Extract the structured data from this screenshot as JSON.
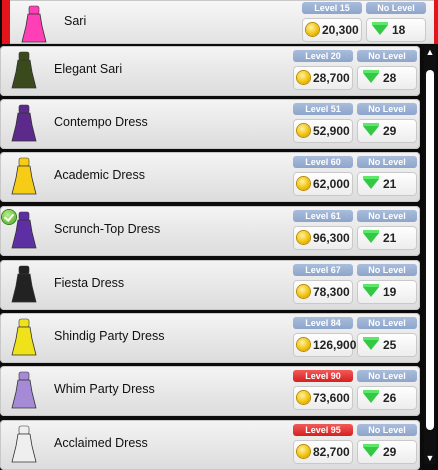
{
  "items": [
    {
      "name": "Sari",
      "level": "Level 15",
      "level_color": "blue",
      "coins": "20,300",
      "gem_level": "No Level",
      "gems": "18",
      "dress_color": "#ff3fb6",
      "owned": false
    },
    {
      "name": "Elegant Sari",
      "level": "Level 20",
      "level_color": "blue",
      "coins": "28,700",
      "gem_level": "No Level",
      "gems": "28",
      "dress_color": "#3a4a1d",
      "owned": false
    },
    {
      "name": "Contempo Dress",
      "level": "Level 51",
      "level_color": "blue",
      "coins": "52,900",
      "gem_level": "No Level",
      "gems": "29",
      "dress_color": "#5b2a8a",
      "owned": false
    },
    {
      "name": "Academic Dress",
      "level": "Level 60",
      "level_color": "blue",
      "coins": "62,000",
      "gem_level": "No Level",
      "gems": "21",
      "dress_color": "#f6cc16",
      "owned": false
    },
    {
      "name": "Scrunch-Top Dress",
      "level": "Level 61",
      "level_color": "blue",
      "coins": "96,300",
      "gem_level": "No Level",
      "gems": "21",
      "dress_color": "#5e2fa3",
      "owned": true
    },
    {
      "name": "Fiesta Dress",
      "level": "Level 67",
      "level_color": "blue",
      "coins": "78,300",
      "gem_level": "No Level",
      "gems": "19",
      "dress_color": "#222222",
      "owned": false
    },
    {
      "name": "Shindig Party Dress",
      "level": "Level 84",
      "level_color": "blue",
      "coins": "126,900",
      "gem_level": "No Level",
      "gems": "25",
      "dress_color": "#f0e21a",
      "owned": false
    },
    {
      "name": "Whim Party Dress",
      "level": "Level 90",
      "level_color": "red",
      "coins": "73,600",
      "gem_level": "No Level",
      "gems": "26",
      "dress_color": "#a58bd6",
      "owned": false
    },
    {
      "name": "Acclaimed Dress",
      "level": "Level 95",
      "level_color": "red",
      "coins": "82,700",
      "gem_level": "No Level",
      "gems": "29",
      "dress_color": "#efefef",
      "owned": false
    }
  ],
  "scrollbar": {
    "up_icon": "▲",
    "down_icon": "▼"
  }
}
